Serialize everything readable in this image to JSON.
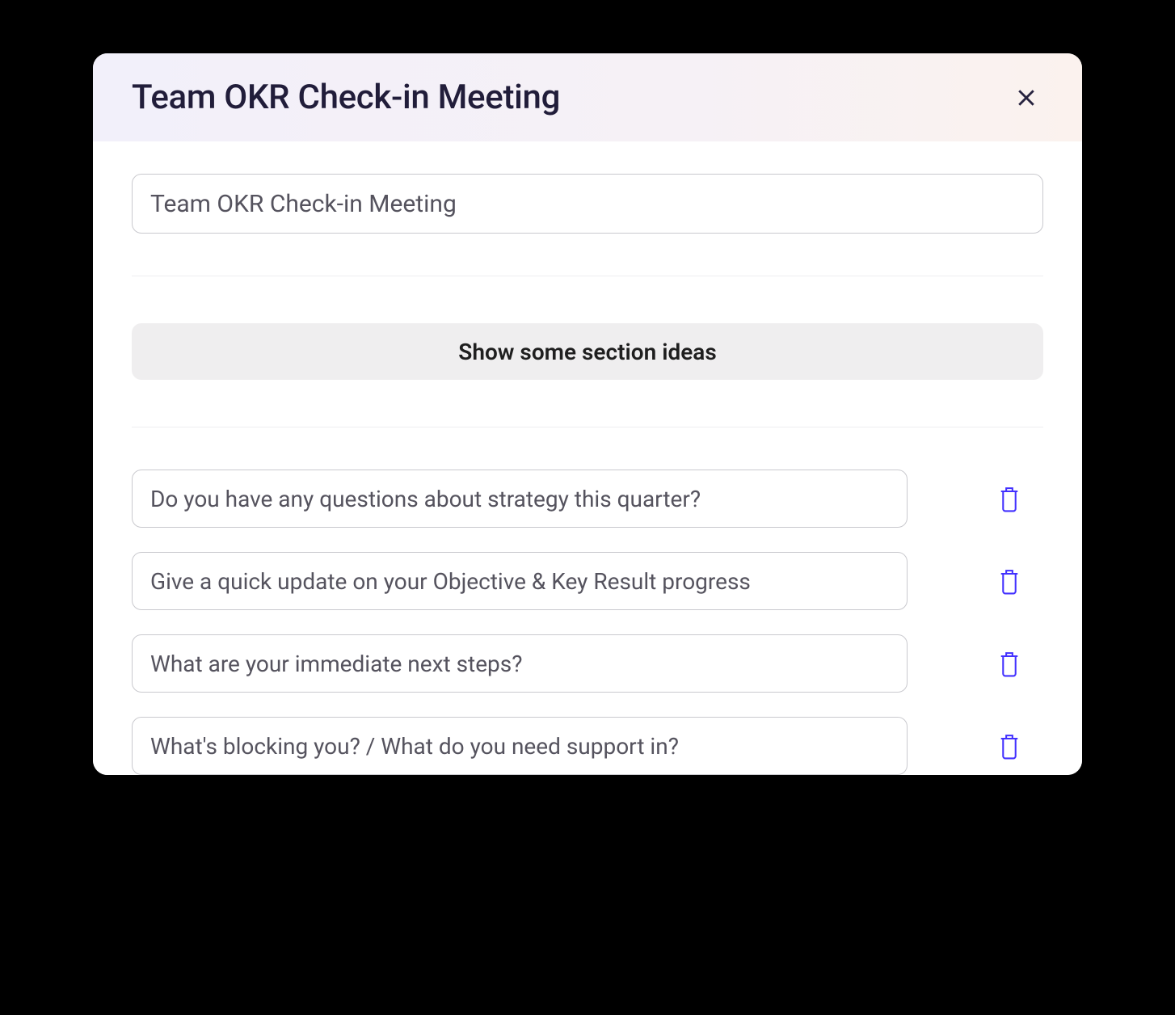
{
  "modal": {
    "title": "Team OKR Check-in Meeting",
    "titleInput": "Team OKR Check-in Meeting",
    "sectionIdeasButton": "Show some section ideas",
    "questions": [
      "Do you have any questions about strategy this quarter?",
      "Give a quick update on your Objective & Key Result progress",
      "What are your immediate next steps?",
      "What's blocking you? / What do you need support in?"
    ]
  },
  "colors": {
    "accent": "#4230ff",
    "textDark": "#211d3a",
    "textMuted": "#55535e",
    "border": "#c9c9ce",
    "buttonBg": "#efeeef"
  }
}
